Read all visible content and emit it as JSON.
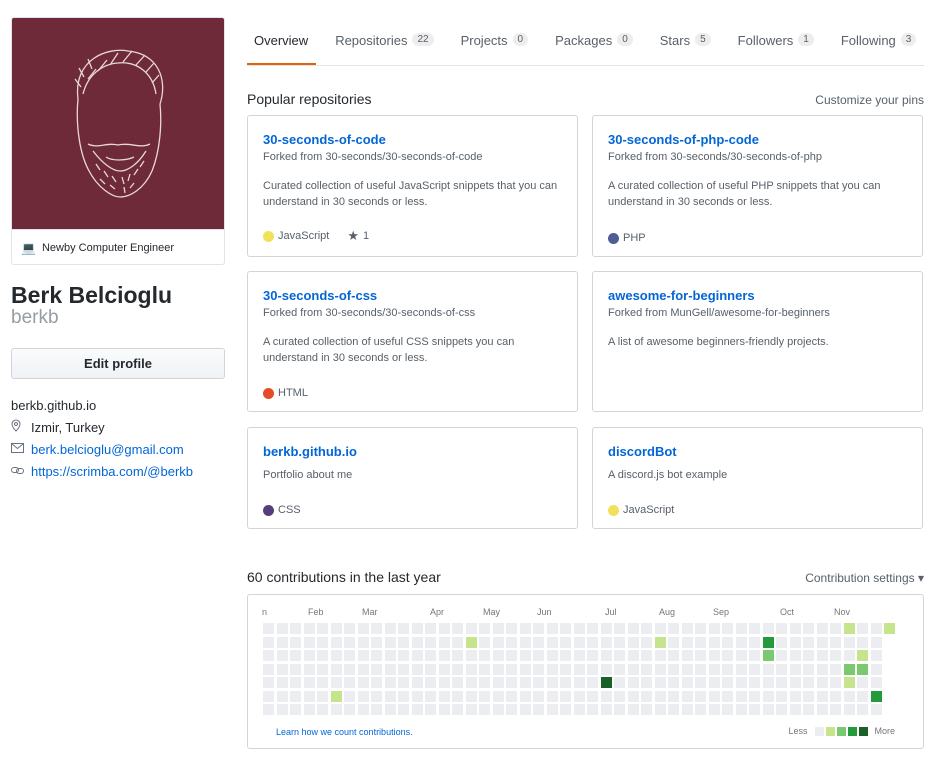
{
  "profile": {
    "status": "Newby Computer Engineer",
    "fullname": "Berk Belcioglu",
    "username": "berkb",
    "edit_label": "Edit profile",
    "website_plain": "berkb.github.io",
    "location": "Izmir, Turkey",
    "email": "berk.belcioglu@gmail.com",
    "link": "https://scrimba.com/@berkb"
  },
  "tabs": [
    {
      "label": "Overview",
      "count": ""
    },
    {
      "label": "Repositories",
      "count": "22"
    },
    {
      "label": "Projects",
      "count": "0"
    },
    {
      "label": "Packages",
      "count": "0"
    },
    {
      "label": "Stars",
      "count": "5"
    },
    {
      "label": "Followers",
      "count": "1"
    },
    {
      "label": "Following",
      "count": "3"
    }
  ],
  "popular": {
    "title": "Popular repositories",
    "customize": "Customize your pins",
    "repos": [
      {
        "name": "30-seconds-of-code",
        "fork": "Forked from 30-seconds/30-seconds-of-code",
        "desc": "Curated collection of useful JavaScript snippets that you can understand in 30 seconds or less.",
        "lang": "JavaScript",
        "lang_color": "#f1e05a",
        "stars": "1"
      },
      {
        "name": "30-seconds-of-php-code",
        "fork": "Forked from 30-seconds/30-seconds-of-php",
        "desc": "A curated collection of useful PHP snippets that you can understand in 30 seconds or less.",
        "lang": "PHP",
        "lang_color": "#4F5D95",
        "stars": ""
      },
      {
        "name": "30-seconds-of-css",
        "fork": "Forked from 30-seconds/30-seconds-of-css",
        "desc": "A curated collection of useful CSS snippets you can understand in 30 seconds or less.",
        "lang": "HTML",
        "lang_color": "#e34c26",
        "stars": ""
      },
      {
        "name": "awesome-for-beginners",
        "fork": "Forked from MunGell/awesome-for-beginners",
        "desc": "A list of awesome beginners-friendly projects.",
        "lang": "",
        "lang_color": "",
        "stars": ""
      },
      {
        "name": "berkb.github.io",
        "fork": "",
        "desc": "Portfolio about me",
        "lang": "CSS",
        "lang_color": "#563d7c",
        "stars": ""
      },
      {
        "name": "discordBot",
        "fork": "",
        "desc": "A discord.js bot example",
        "lang": "JavaScript",
        "lang_color": "#f1e05a",
        "stars": ""
      }
    ]
  },
  "contributions": {
    "title": "60 contributions in the last year",
    "settings": "Contribution settings",
    "months": [
      "n",
      "Feb",
      "Mar",
      "Apr",
      "May",
      "Jun",
      "Jul",
      "Aug",
      "Sep",
      "Oct",
      "Nov"
    ],
    "learn": "Learn how we count contributions.",
    "less": "Less",
    "more": "More",
    "levels": [
      "#ebedf0",
      "#c6e48b",
      "#7bc96f",
      "#239a3b",
      "#196127"
    ],
    "active_cells": [
      {
        "week": 15,
        "day": 1,
        "level": 1
      },
      {
        "week": 29,
        "day": 1,
        "level": 1
      },
      {
        "week": 37,
        "day": 1,
        "level": 3
      },
      {
        "week": 37,
        "day": 2,
        "level": 2
      },
      {
        "week": 25,
        "day": 4,
        "level": 4
      },
      {
        "week": 5,
        "day": 5,
        "level": 1
      },
      {
        "week": 43,
        "day": 0,
        "level": 1
      },
      {
        "week": 44,
        "day": 2,
        "level": 1
      },
      {
        "week": 43,
        "day": 3,
        "level": 2
      },
      {
        "week": 44,
        "day": 3,
        "level": 2
      },
      {
        "week": 43,
        "day": 4,
        "level": 1
      },
      {
        "week": 45,
        "day": 5,
        "level": 3
      },
      {
        "week": 46,
        "day": 0,
        "level": 1
      }
    ]
  }
}
